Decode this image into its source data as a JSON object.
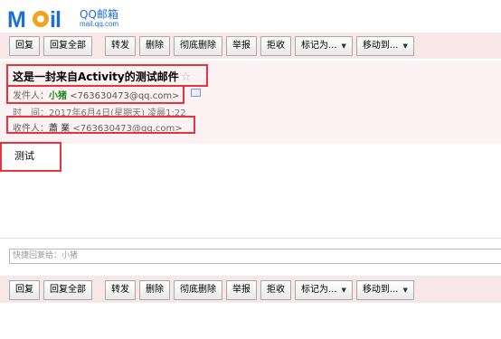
{
  "logo": {
    "brand": "QQ邮箱",
    "sub": "mail.qq.com",
    "mark": "MOil"
  },
  "toolbar": {
    "reply": "回复",
    "reply_all": "回复全部",
    "forward": "转发",
    "delete": "删除",
    "delete_permanently": "彻底删除",
    "report": "举报",
    "reject": "拒收",
    "mark_as": "标记为...",
    "move_to": "移动到..."
  },
  "message": {
    "subject": "这是一封来自Activity的测试邮件",
    "from_label": "发件人：",
    "from_name": "小猪",
    "from_addr": "<763630473@qq.com>",
    "time_label": "时　间：",
    "time_value": "2017年6月4日(星期天) 凌晨1:22",
    "to_label": "收件人：",
    "to_name": "蕭 業",
    "to_addr": "<763630473@qq.com>",
    "body": "测试"
  },
  "quick_reply": {
    "placeholder": "快捷回复给：小猪"
  },
  "colors": {
    "highlight": "#e8333d",
    "accent": "#1b6fd8",
    "band": "#f8e8ea"
  }
}
